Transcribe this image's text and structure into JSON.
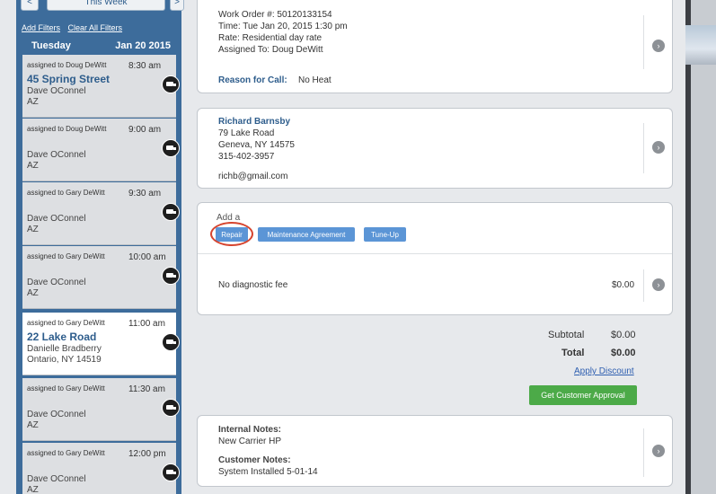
{
  "nav": {
    "prev_label": "<",
    "week_label": "This Week",
    "next_label": ">"
  },
  "filters": {
    "add_label": "Add Filters",
    "clear_label": "Clear All Filters"
  },
  "day": {
    "name": "Tuesday",
    "date": "Jan 20 2015"
  },
  "appointments": [
    {
      "assigned": "assigned to Doug DeWitt",
      "time": "8:30 am",
      "street": "45 Spring Street",
      "line1": "Dave OConnel",
      "line2": "AZ"
    },
    {
      "assigned": "assigned to Doug DeWitt",
      "time": "9:00 am",
      "street": "",
      "line1": "Dave OConnel",
      "line2": "AZ"
    },
    {
      "assigned": "assigned to Gary DeWitt",
      "time": "9:30 am",
      "street": "",
      "line1": "Dave OConnel",
      "line2": "AZ"
    },
    {
      "assigned": "assigned to Gary DeWitt",
      "time": "10:00 am",
      "street": "",
      "line1": "Dave OConnel",
      "line2": "AZ"
    },
    {
      "assigned": "assigned to Gary DeWitt",
      "time": "11:00 am",
      "street": "22 Lake Road",
      "line1": "Danielle Bradberry",
      "line2": "Ontario, NY 14519",
      "selected": true
    },
    {
      "assigned": "assigned to Gary DeWitt",
      "time": "11:30 am",
      "street": "",
      "line1": "Dave OConnel",
      "line2": "AZ"
    },
    {
      "assigned": "assigned to Gary DeWitt",
      "time": "12:00 pm",
      "street": "",
      "line1": "Dave OConnel",
      "line2": "AZ"
    }
  ],
  "work_order": {
    "number": "Work Order #: 50120133154",
    "time": "Time: Tue Jan 20, 2015 1:30 pm",
    "rate": "Rate: Residential day rate",
    "assigned": "Assigned To: Doug DeWitt",
    "reason_label": "Reason for Call:",
    "reason_value": "No Heat"
  },
  "customer": {
    "name": "Richard Barnsby",
    "address1": "79 Lake Road",
    "address2": "Geneva, NY 14575",
    "phone": "315-402-3957",
    "email": "richb@gmail.com"
  },
  "add_section": {
    "label": "Add a",
    "buttons": [
      "Repair",
      "Maintenance Agreement",
      "Tune-Up"
    ],
    "fee_label": "No diagnostic fee",
    "fee_value": "$0.00"
  },
  "totals": {
    "subtotal_label": "Subtotal",
    "subtotal_value": "$0.00",
    "total_label": "Total",
    "total_value": "$0.00",
    "discount_label": "Apply Discount",
    "approve_label": "Get Customer Approval"
  },
  "notes": {
    "internal_label": "Internal Notes:",
    "internal_value": "New Carrier HP",
    "customer_label": "Customer Notes:",
    "customer_value": "System Installed 5-01-14"
  },
  "chevron_glyph": "›",
  "colors": {
    "sidebar": "#3d6c9b",
    "accent": "#2e5d8c",
    "button_blue": "#5b95d6",
    "approve_green": "#4caa48",
    "highlight_red": "#d6452f"
  }
}
